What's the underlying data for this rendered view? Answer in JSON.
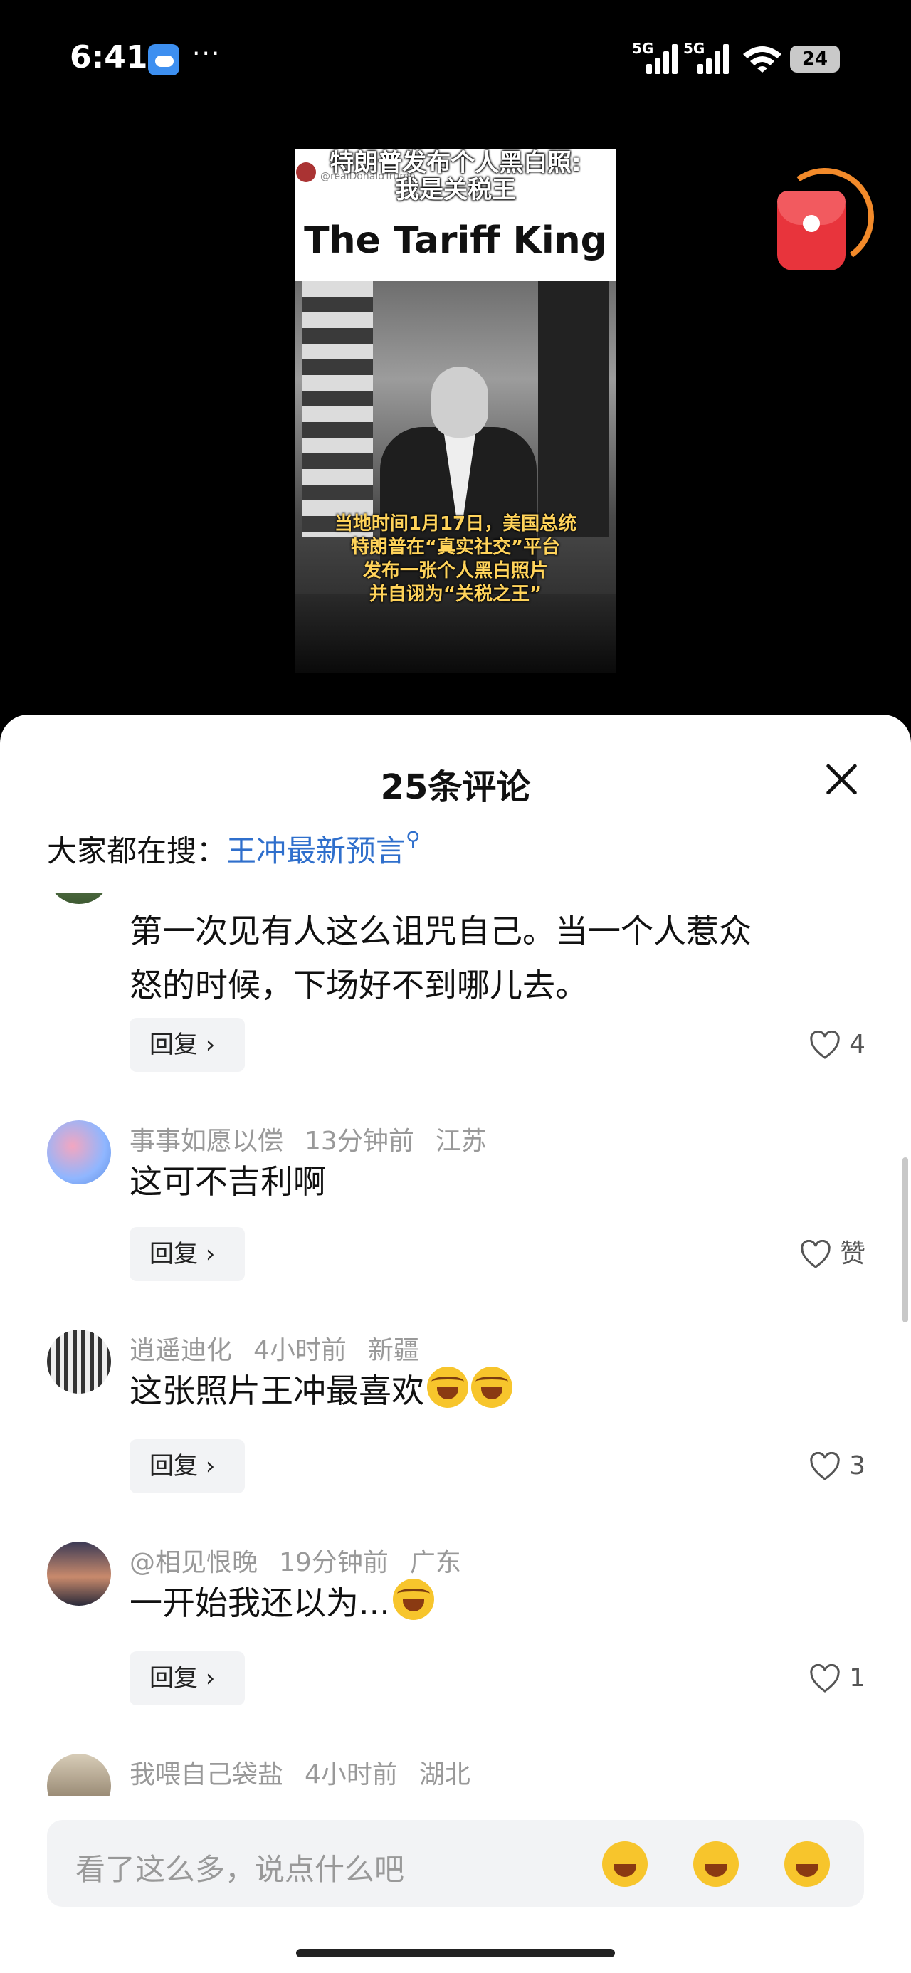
{
  "status_bar": {
    "time": "6:41",
    "more": "···",
    "network1": "5G",
    "network2": "5G",
    "battery": "24"
  },
  "video": {
    "top_caption_line1": "特朗普发布个人黑白照:",
    "top_caption_line2": "我是关税王",
    "handle": "@realDonaldTrump",
    "headline": "The Tariff King",
    "bottom_caption": [
      "当地时间1月17日，美国总统",
      "特朗普在“真实社交”平台",
      "发布一张个人黑白照片",
      "并自诩为“关税之王”"
    ]
  },
  "sheet": {
    "title": "25条评论",
    "search_prefix": "大家都在搜：",
    "search_link": "王冲最新预言",
    "search_icon": "magnifier-icon"
  },
  "comments": [
    {
      "user": "",
      "time": "",
      "location": "",
      "text_line1": "第一次见有人这么诅咒自己。当一个人惹众",
      "text_line2": "怒的时候，下场好不到哪儿去。",
      "reply_label": "回复 ›",
      "likes": "4"
    },
    {
      "user": "事事如愿以偿",
      "time": "13分钟前",
      "location": "江苏",
      "text_line1": "这可不吉利啊",
      "reply_label": "回复 ›",
      "likes": "赞"
    },
    {
      "user": "逍遥迪化",
      "time": "4小时前",
      "location": "新疆",
      "text_line1": "这张照片王冲最喜欢",
      "reply_label": "回复 ›",
      "likes": "3"
    },
    {
      "user": "@相见恨晚",
      "time": "19分钟前",
      "location": "广东",
      "text_line1": "一开始我还以为...",
      "reply_label": "回复 ›",
      "likes": "1"
    },
    {
      "user": "我喂自己袋盐",
      "time": "4小时前",
      "location": "湖北"
    }
  ],
  "input": {
    "placeholder": "看了这么多，说点什么吧",
    "emoji_icons": [
      "laughing-crying-emoji-icon",
      "star-eyes-emoji-icon",
      "grinning-emoji-icon"
    ]
  },
  "colors": {
    "link": "#2f6fcc",
    "accent_red": "#e8343c",
    "ring_orange": "#f28a2a"
  }
}
